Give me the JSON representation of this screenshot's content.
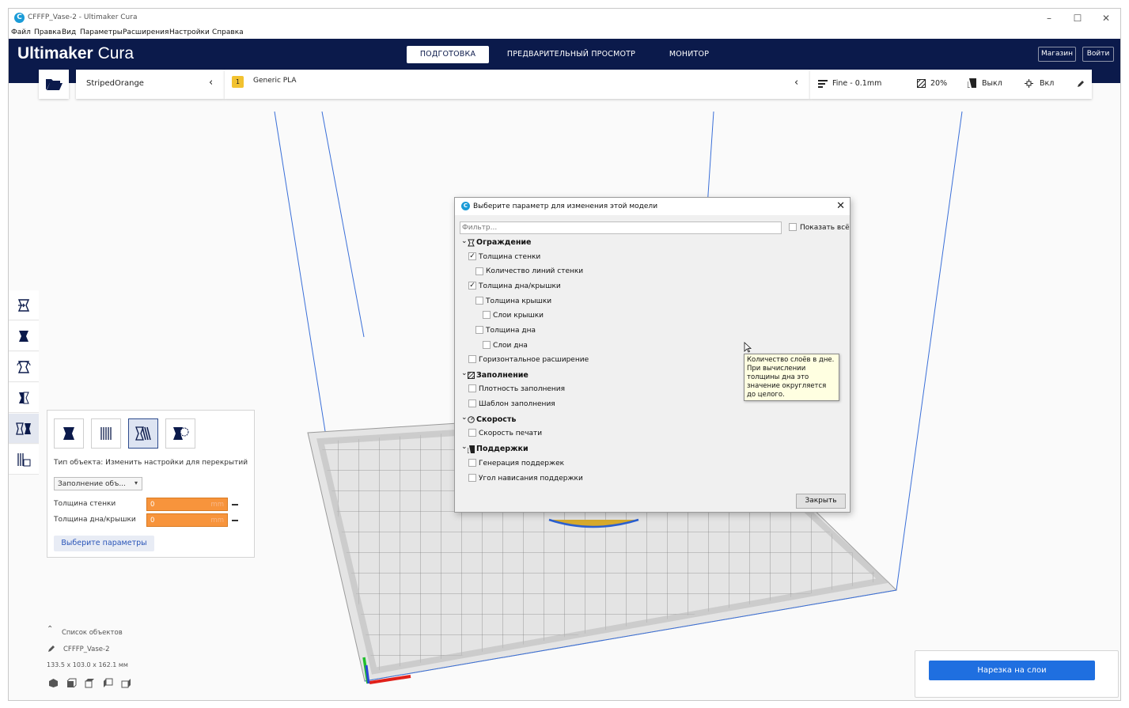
{
  "window": {
    "title": "CFFFP_Vase-2 - Ultimaker Cura",
    "app_icon_letter": "C",
    "controls": [
      "–",
      "☐",
      "✕"
    ]
  },
  "menu": [
    "Файл",
    "Правка",
    "Вид",
    "Параметры",
    "Расширения",
    "Настройки",
    "Справка"
  ],
  "header": {
    "logo_bold": "Ultimaker",
    "logo_light": "Cura",
    "tabs": [
      {
        "label": "ПОДГОТОВКА",
        "active": true
      },
      {
        "label": "ПРЕДВАРИТЕЛЬНЫЙ ПРОСМОТР",
        "active": false
      },
      {
        "label": "МОНИТОР",
        "active": false
      }
    ],
    "marketplace_button": "Магазин",
    "signin_button": "Войти"
  },
  "toolbar": {
    "printer": "StripedOrange",
    "material_badge": "1",
    "material": "Generic PLA",
    "profile": "Fine - 0.1mm",
    "infill": "20%",
    "support": "Выкл",
    "adhesion": "Вкл"
  },
  "per_model_panel": {
    "mesh_type_label": "Тип объекта: Изменить настройки для перекрытий",
    "dropdown_value": "Заполнение объ...",
    "settings": [
      {
        "label": "Толщина стенки",
        "value": "0",
        "unit": "mm"
      },
      {
        "label": "Толщина дна/крышки",
        "value": "0",
        "unit": "mm"
      }
    ],
    "select_settings_button": "Выберите параметры"
  },
  "object_list": {
    "header": "Список объектов",
    "object_name": "CFFFP_Vase-2",
    "dimensions": "133.5 x 103.0 x 162.1 мм"
  },
  "slice_button": "Нарезка на слои",
  "dialog": {
    "title": "Выберите параметр для изменения этой модели",
    "filter_placeholder": "Фильтр...",
    "show_all_label": "Показать всё",
    "categories": [
      {
        "label": "Ограждение"
      },
      {
        "label": "Заполнение"
      },
      {
        "label": "Скорость"
      },
      {
        "label": "Поддержки"
      }
    ],
    "rows": [
      {
        "label": "Толщина стенки",
        "checked": true
      },
      {
        "label": "Количество линий стенки",
        "checked": false
      },
      {
        "label": "Толщина дна/крышки",
        "checked": true
      },
      {
        "label": "Толщина крышки",
        "checked": false
      },
      {
        "label": "Слои крышки",
        "checked": false
      },
      {
        "label": "Толщина дна",
        "checked": false
      },
      {
        "label": "Слои дна",
        "checked": false
      },
      {
        "label": "Горизонтальное расширение",
        "checked": false
      },
      {
        "label": "Плотность заполнения",
        "checked": false
      },
      {
        "label": "Шаблон заполнения",
        "checked": false
      },
      {
        "label": "Скорость печати",
        "checked": false
      },
      {
        "label": "Генерация поддержек",
        "checked": false
      },
      {
        "label": "Угол нависания поддержки",
        "checked": false
      }
    ],
    "close_button": "Закрыть",
    "tooltip": "Количество слоёв в дне. При вычислении толщины дна это значение округляется до целого."
  },
  "colors": {
    "header_bg": "#0b1a4b",
    "accent_blue": "#1f6fe0",
    "input_orange": "#f7943c",
    "tooltip_bg": "#ffffe1"
  }
}
